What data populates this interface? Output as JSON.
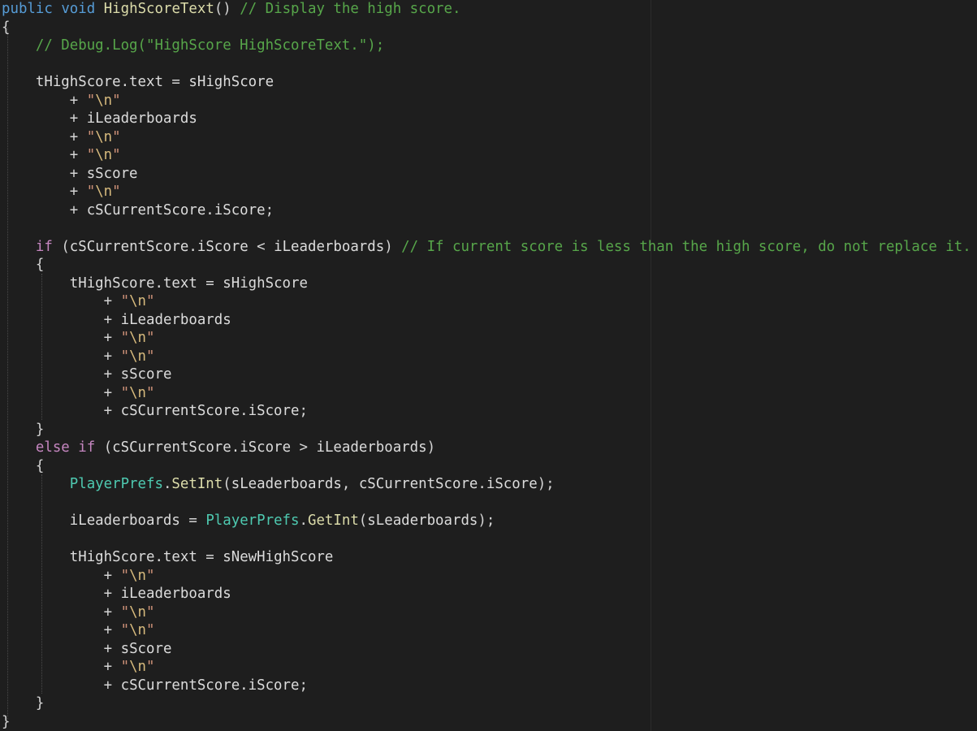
{
  "editor": {
    "theme": {
      "background": "#1e1e1e",
      "keyword": "#569cd6",
      "control_keyword": "#c586c0",
      "method": "#dcdcaa",
      "string": "#ce9178",
      "escape": "#d7ba7d",
      "comment": "#57a64a",
      "type": "#4ec9b0",
      "identifier": "#dcdcdc"
    },
    "lines": [
      [
        {
          "c": "kw",
          "t": "public"
        },
        {
          "c": "op",
          "t": " "
        },
        {
          "c": "kw",
          "t": "void"
        },
        {
          "c": "op",
          "t": " "
        },
        {
          "c": "fn",
          "t": "HighScoreText"
        },
        {
          "c": "op",
          "t": "() "
        },
        {
          "c": "cm",
          "t": "// Display the high score."
        }
      ],
      [
        {
          "c": "op",
          "t": "{"
        }
      ],
      [
        {
          "c": "op",
          "t": "    "
        },
        {
          "c": "cm",
          "t": "// Debug.Log(\"HighScore HighScoreText.\");"
        }
      ],
      [],
      [
        {
          "c": "op",
          "t": "    "
        },
        {
          "c": "id",
          "t": "tHighScore.text"
        },
        {
          "c": "op",
          "t": " = "
        },
        {
          "c": "id",
          "t": "sHighScore"
        }
      ],
      [
        {
          "c": "op",
          "t": "        + "
        },
        {
          "c": "str",
          "t": "\""
        },
        {
          "c": "esc",
          "t": "\\n"
        },
        {
          "c": "str",
          "t": "\""
        }
      ],
      [
        {
          "c": "op",
          "t": "        + "
        },
        {
          "c": "id",
          "t": "iLeaderboards"
        }
      ],
      [
        {
          "c": "op",
          "t": "        + "
        },
        {
          "c": "str",
          "t": "\""
        },
        {
          "c": "esc",
          "t": "\\n"
        },
        {
          "c": "str",
          "t": "\""
        }
      ],
      [
        {
          "c": "op",
          "t": "        + "
        },
        {
          "c": "str",
          "t": "\""
        },
        {
          "c": "esc",
          "t": "\\n"
        },
        {
          "c": "str",
          "t": "\""
        }
      ],
      [
        {
          "c": "op",
          "t": "        + "
        },
        {
          "c": "id",
          "t": "sScore"
        }
      ],
      [
        {
          "c": "op",
          "t": "        + "
        },
        {
          "c": "str",
          "t": "\""
        },
        {
          "c": "esc",
          "t": "\\n"
        },
        {
          "c": "str",
          "t": "\""
        }
      ],
      [
        {
          "c": "op",
          "t": "        + "
        },
        {
          "c": "id",
          "t": "cSCurrentScore.iScore"
        },
        {
          "c": "op",
          "t": ";"
        }
      ],
      [],
      [
        {
          "c": "op",
          "t": "    "
        },
        {
          "c": "ctl",
          "t": "if"
        },
        {
          "c": "op",
          "t": " ("
        },
        {
          "c": "id",
          "t": "cSCurrentScore.iScore"
        },
        {
          "c": "op",
          "t": " < "
        },
        {
          "c": "id",
          "t": "iLeaderboards"
        },
        {
          "c": "op",
          "t": ") "
        },
        {
          "c": "cm",
          "t": "// If current score is less than the high score, do not replace it."
        }
      ],
      [
        {
          "c": "op",
          "t": "    {"
        }
      ],
      [
        {
          "c": "op",
          "t": "        "
        },
        {
          "c": "id",
          "t": "tHighScore.text"
        },
        {
          "c": "op",
          "t": " = "
        },
        {
          "c": "id",
          "t": "sHighScore"
        }
      ],
      [
        {
          "c": "op",
          "t": "            + "
        },
        {
          "c": "str",
          "t": "\""
        },
        {
          "c": "esc",
          "t": "\\n"
        },
        {
          "c": "str",
          "t": "\""
        }
      ],
      [
        {
          "c": "op",
          "t": "            + "
        },
        {
          "c": "id",
          "t": "iLeaderboards"
        }
      ],
      [
        {
          "c": "op",
          "t": "            + "
        },
        {
          "c": "str",
          "t": "\""
        },
        {
          "c": "esc",
          "t": "\\n"
        },
        {
          "c": "str",
          "t": "\""
        }
      ],
      [
        {
          "c": "op",
          "t": "            + "
        },
        {
          "c": "str",
          "t": "\""
        },
        {
          "c": "esc",
          "t": "\\n"
        },
        {
          "c": "str",
          "t": "\""
        }
      ],
      [
        {
          "c": "op",
          "t": "            + "
        },
        {
          "c": "id",
          "t": "sScore"
        }
      ],
      [
        {
          "c": "op",
          "t": "            + "
        },
        {
          "c": "str",
          "t": "\""
        },
        {
          "c": "esc",
          "t": "\\n"
        },
        {
          "c": "str",
          "t": "\""
        }
      ],
      [
        {
          "c": "op",
          "t": "            + "
        },
        {
          "c": "id",
          "t": "cSCurrentScore.iScore"
        },
        {
          "c": "op",
          "t": ";"
        }
      ],
      [
        {
          "c": "op",
          "t": "    }"
        }
      ],
      [
        {
          "c": "op",
          "t": "    "
        },
        {
          "c": "ctl",
          "t": "else"
        },
        {
          "c": "op",
          "t": " "
        },
        {
          "c": "ctl",
          "t": "if"
        },
        {
          "c": "op",
          "t": " ("
        },
        {
          "c": "id",
          "t": "cSCurrentScore.iScore"
        },
        {
          "c": "op",
          "t": " > "
        },
        {
          "c": "id",
          "t": "iLeaderboards"
        },
        {
          "c": "op",
          "t": ")"
        }
      ],
      [
        {
          "c": "op",
          "t": "    {"
        }
      ],
      [
        {
          "c": "op",
          "t": "        "
        },
        {
          "c": "ty",
          "t": "PlayerPrefs"
        },
        {
          "c": "op",
          "t": "."
        },
        {
          "c": "fn",
          "t": "SetInt"
        },
        {
          "c": "op",
          "t": "("
        },
        {
          "c": "id",
          "t": "sLeaderboards"
        },
        {
          "c": "op",
          "t": ", "
        },
        {
          "c": "id",
          "t": "cSCurrentScore.iScore"
        },
        {
          "c": "op",
          "t": ");"
        }
      ],
      [],
      [
        {
          "c": "op",
          "t": "        "
        },
        {
          "c": "id",
          "t": "iLeaderboards"
        },
        {
          "c": "op",
          "t": " = "
        },
        {
          "c": "ty",
          "t": "PlayerPrefs"
        },
        {
          "c": "op",
          "t": "."
        },
        {
          "c": "fn",
          "t": "GetInt"
        },
        {
          "c": "op",
          "t": "("
        },
        {
          "c": "id",
          "t": "sLeaderboards"
        },
        {
          "c": "op",
          "t": ");"
        }
      ],
      [],
      [
        {
          "c": "op",
          "t": "        "
        },
        {
          "c": "id",
          "t": "tHighScore.text"
        },
        {
          "c": "op",
          "t": " = "
        },
        {
          "c": "id",
          "t": "sNewHighScore"
        }
      ],
      [
        {
          "c": "op",
          "t": "            + "
        },
        {
          "c": "str",
          "t": "\""
        },
        {
          "c": "esc",
          "t": "\\n"
        },
        {
          "c": "str",
          "t": "\""
        }
      ],
      [
        {
          "c": "op",
          "t": "            + "
        },
        {
          "c": "id",
          "t": "iLeaderboards"
        }
      ],
      [
        {
          "c": "op",
          "t": "            + "
        },
        {
          "c": "str",
          "t": "\""
        },
        {
          "c": "esc",
          "t": "\\n"
        },
        {
          "c": "str",
          "t": "\""
        }
      ],
      [
        {
          "c": "op",
          "t": "            + "
        },
        {
          "c": "str",
          "t": "\""
        },
        {
          "c": "esc",
          "t": "\\n"
        },
        {
          "c": "str",
          "t": "\""
        }
      ],
      [
        {
          "c": "op",
          "t": "            + "
        },
        {
          "c": "id",
          "t": "sScore"
        }
      ],
      [
        {
          "c": "op",
          "t": "            + "
        },
        {
          "c": "str",
          "t": "\""
        },
        {
          "c": "esc",
          "t": "\\n"
        },
        {
          "c": "str",
          "t": "\""
        }
      ],
      [
        {
          "c": "op",
          "t": "            + "
        },
        {
          "c": "id",
          "t": "cSCurrentScore.iScore"
        },
        {
          "c": "op",
          "t": ";"
        }
      ],
      [
        {
          "c": "op",
          "t": "    }"
        }
      ],
      [
        {
          "c": "op",
          "t": "}"
        }
      ]
    ]
  }
}
